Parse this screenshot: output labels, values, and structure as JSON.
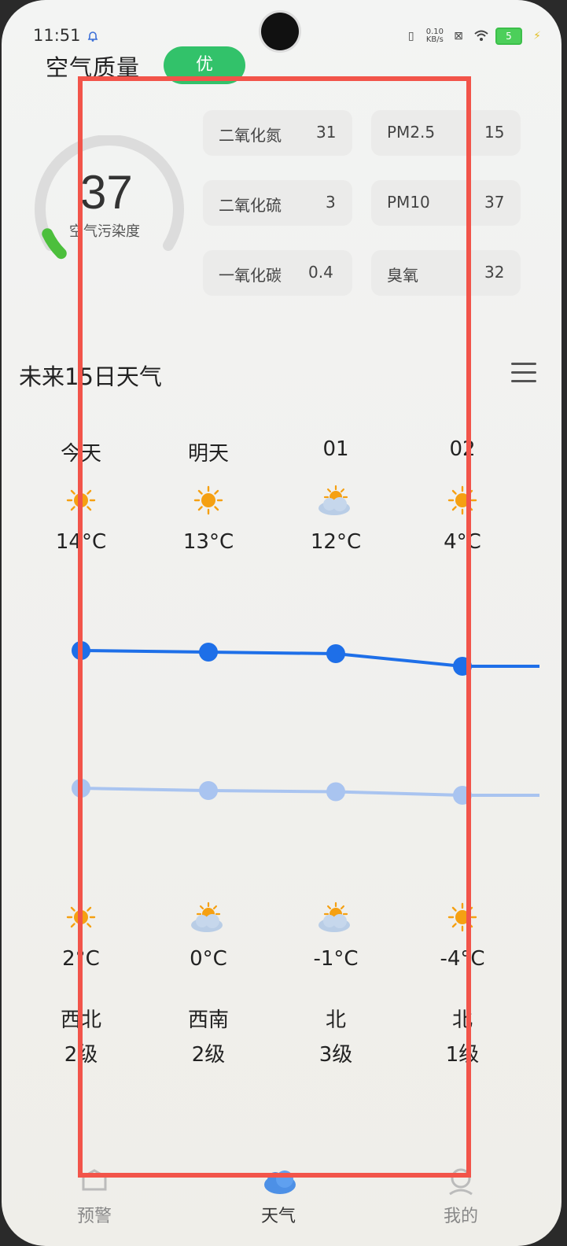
{
  "status_bar": {
    "time": "11:51",
    "net_speed_value": "0.10",
    "net_speed_unit": "KB/s",
    "battery": "5"
  },
  "air_quality": {
    "title": "空气质量",
    "badge": "优",
    "badge_color": "#32c26a",
    "aqi": 37,
    "aqi_max": 500,
    "gauge_label": "空气污染度",
    "pollutants": [
      {
        "name": "二氧化氮",
        "value": "31"
      },
      {
        "name": "PM2.5",
        "value": "15"
      },
      {
        "name": "二氧化硫",
        "value": "3"
      },
      {
        "name": "PM10",
        "value": "37"
      },
      {
        "name": "一氧化碳",
        "value": "0.4"
      },
      {
        "name": "臭氧",
        "value": "32"
      }
    ]
  },
  "forecast": {
    "title": "未来15日天气",
    "days": [
      {
        "label": "今天",
        "day_icon": "sun-icon",
        "high": "14°C",
        "night_icon": "sun-icon",
        "low": "2°C",
        "wind": "西北",
        "level": "2级"
      },
      {
        "label": "明天",
        "day_icon": "sun-icon",
        "high": "13°C",
        "night_icon": "partly-cloudy-icon",
        "low": "0°C",
        "wind": "西南",
        "level": "2级"
      },
      {
        "label": "01",
        "day_icon": "partly-cloudy-icon",
        "high": "12°C",
        "night_icon": "partly-cloudy-icon",
        "low": "-1°C",
        "wind": "北",
        "level": "3级"
      },
      {
        "label": "02",
        "day_icon": "sun-icon",
        "high": "4°C",
        "night_icon": "sun-icon",
        "low": "-4°C",
        "wind": "北",
        "level": "1级"
      }
    ]
  },
  "chart_data": {
    "type": "line",
    "categories": [
      "今天",
      "明天",
      "01",
      "02"
    ],
    "series": [
      {
        "values": [
          14,
          13,
          12,
          4
        ],
        "color": "#1e6fe8"
      },
      {
        "values": [
          2,
          0,
          -1,
          -4
        ],
        "color": "#a9c4f0"
      }
    ]
  },
  "bottom_nav": {
    "items": [
      {
        "label": "预警",
        "icon": "warning-icon"
      },
      {
        "label": "天气",
        "icon": "weather-cloud-icon"
      },
      {
        "label": "我的",
        "icon": "profile-icon"
      }
    ]
  },
  "colors": {
    "highlight": "#f2544a",
    "sun": "#f5a012"
  }
}
